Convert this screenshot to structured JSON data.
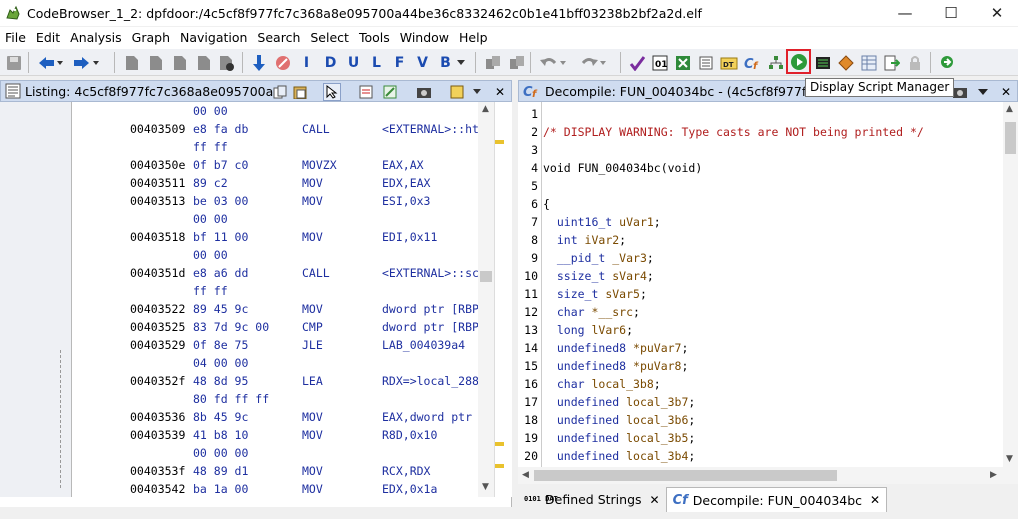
{
  "window": {
    "title": "CodeBrowser_1_2: dpfdoor:/4c5cf8f977fc7c368a8e095700a44be36c8332462c0b1e41bff03238b2bf2a2d.elf",
    "minimize_glyph": "—",
    "maximize_glyph": "☐",
    "close_glyph": "✕"
  },
  "menu": [
    "File",
    "Edit",
    "Analysis",
    "Graph",
    "Navigation",
    "Search",
    "Select",
    "Tools",
    "Window",
    "Help"
  ],
  "toolbar": {
    "letter_buttons": [
      "I",
      "D",
      "U",
      "L",
      "F",
      "V",
      "B"
    ],
    "tooltip": "Display Script Manager",
    "highlight_color": "#e0202a"
  },
  "listing": {
    "title": "Listing:  4c5cf8f977fc7c368a8e095700a44b...",
    "rows": [
      {
        "addr": "",
        "bytes": "00 00",
        "mnem": "",
        "ops": ""
      },
      {
        "addr": "00403509",
        "bytes": "e8 fa db",
        "mnem": "CALL",
        "ops": "<EXTERNAL>::ht"
      },
      {
        "addr": "",
        "bytes": "ff ff",
        "mnem": "",
        "ops": ""
      },
      {
        "addr": "0040350e",
        "bytes": "0f b7 c0",
        "mnem": "MOVZX",
        "ops": "EAX,AX"
      },
      {
        "addr": "00403511",
        "bytes": "89 c2",
        "mnem": "MOV",
        "ops": "EDX,EAX"
      },
      {
        "addr": "00403513",
        "bytes": "be 03 00",
        "mnem": "MOV",
        "ops": "ESI,0x3"
      },
      {
        "addr": "",
        "bytes": "00 00",
        "mnem": "",
        "ops": ""
      },
      {
        "addr": "00403518",
        "bytes": "bf 11 00",
        "mnem": "MOV",
        "ops": "EDI,0x11"
      },
      {
        "addr": "",
        "bytes": "00 00",
        "mnem": "",
        "ops": ""
      },
      {
        "addr": "0040351d",
        "bytes": "e8 a6 dd",
        "mnem": "CALL",
        "ops": "<EXTERNAL>::sc"
      },
      {
        "addr": "",
        "bytes": "ff ff",
        "mnem": "",
        "ops": ""
      },
      {
        "addr": "00403522",
        "bytes": "89 45 9c",
        "mnem": "MOV",
        "ops": "dword ptr [RBP"
      },
      {
        "addr": "00403525",
        "bytes": "83 7d 9c 00",
        "mnem": "CMP",
        "ops": "dword ptr [RBP"
      },
      {
        "addr": "00403529",
        "bytes": "0f 8e 75",
        "mnem": "JLE",
        "ops": "LAB_004039a4"
      },
      {
        "addr": "",
        "bytes": "04 00 00",
        "mnem": "",
        "ops": ""
      },
      {
        "addr": "0040352f",
        "bytes": "48 8d 95",
        "mnem": "LEA",
        "ops": "RDX=>local_288"
      },
      {
        "addr": "",
        "bytes": "80 fd ff ff",
        "mnem": "",
        "ops": ""
      },
      {
        "addr": "00403536",
        "bytes": "8b 45 9c",
        "mnem": "MOV",
        "ops": "EAX,dword ptr"
      },
      {
        "addr": "00403539",
        "bytes": "41 b8 10",
        "mnem": "MOV",
        "ops": "R8D,0x10"
      },
      {
        "addr": "",
        "bytes": "00 00 00",
        "mnem": "",
        "ops": ""
      },
      {
        "addr": "0040353f",
        "bytes": "48 89 d1",
        "mnem": "MOV",
        "ops": "RCX,RDX"
      },
      {
        "addr": "00403542",
        "bytes": "ba 1a 00",
        "mnem": "MOV",
        "ops": "EDX,0x1a"
      }
    ]
  },
  "decompile": {
    "title": "Decompile: FUN_004034bc - (4c5cf8f977fc7...",
    "lines": [
      {
        "n": "1",
        "segs": []
      },
      {
        "n": "2",
        "segs": [
          {
            "t": "/* DISPLAY WARNING: Type casts are NOT being printed */",
            "c": "comment"
          }
        ]
      },
      {
        "n": "3",
        "segs": []
      },
      {
        "n": "4",
        "segs": [
          {
            "t": "void FUN_004034bc(void)",
            "c": "plain"
          }
        ]
      },
      {
        "n": "5",
        "segs": []
      },
      {
        "n": "6",
        "segs": [
          {
            "t": "{",
            "c": "plain"
          }
        ]
      },
      {
        "n": "7",
        "segs": [
          {
            "t": "  uint16_t ",
            "c": "type"
          },
          {
            "t": "uVar1",
            "c": "var"
          },
          {
            "t": ";",
            "c": "plain"
          }
        ]
      },
      {
        "n": "8",
        "segs": [
          {
            "t": "  int ",
            "c": "type"
          },
          {
            "t": "iVar2",
            "c": "var"
          },
          {
            "t": ";",
            "c": "plain"
          }
        ]
      },
      {
        "n": "9",
        "segs": [
          {
            "t": "  __pid_t ",
            "c": "type"
          },
          {
            "t": "_Var3",
            "c": "var"
          },
          {
            "t": ";",
            "c": "plain"
          }
        ]
      },
      {
        "n": "10",
        "segs": [
          {
            "t": "  ssize_t ",
            "c": "type"
          },
          {
            "t": "sVar4",
            "c": "var"
          },
          {
            "t": ";",
            "c": "plain"
          }
        ]
      },
      {
        "n": "11",
        "segs": [
          {
            "t": "  size_t ",
            "c": "type"
          },
          {
            "t": "sVar5",
            "c": "var"
          },
          {
            "t": ";",
            "c": "plain"
          }
        ]
      },
      {
        "n": "12",
        "segs": [
          {
            "t": "  char ",
            "c": "type"
          },
          {
            "t": "*__src",
            "c": "var"
          },
          {
            "t": ";",
            "c": "plain"
          }
        ]
      },
      {
        "n": "13",
        "segs": [
          {
            "t": "  long ",
            "c": "type"
          },
          {
            "t": "lVar6",
            "c": "var"
          },
          {
            "t": ";",
            "c": "plain"
          }
        ]
      },
      {
        "n": "14",
        "segs": [
          {
            "t": "  undefined8 ",
            "c": "type"
          },
          {
            "t": "*puVar7",
            "c": "var"
          },
          {
            "t": ";",
            "c": "plain"
          }
        ]
      },
      {
        "n": "15",
        "segs": [
          {
            "t": "  undefined8 ",
            "c": "type"
          },
          {
            "t": "*puVar8",
            "c": "var"
          },
          {
            "t": ";",
            "c": "plain"
          }
        ]
      },
      {
        "n": "16",
        "segs": [
          {
            "t": "  char ",
            "c": "type"
          },
          {
            "t": "local_3b8",
            "c": "var"
          },
          {
            "t": ";",
            "c": "plain"
          }
        ]
      },
      {
        "n": "17",
        "segs": [
          {
            "t": "  undefined ",
            "c": "type"
          },
          {
            "t": "local_3b7",
            "c": "var"
          },
          {
            "t": ";",
            "c": "plain"
          }
        ]
      },
      {
        "n": "18",
        "segs": [
          {
            "t": "  undefined ",
            "c": "type"
          },
          {
            "t": "local_3b6",
            "c": "var"
          },
          {
            "t": ";",
            "c": "plain"
          }
        ]
      },
      {
        "n": "19",
        "segs": [
          {
            "t": "  undefined ",
            "c": "type"
          },
          {
            "t": "local_3b5",
            "c": "var"
          },
          {
            "t": ";",
            "c": "plain"
          }
        ]
      },
      {
        "n": "20",
        "segs": [
          {
            "t": "  undefined ",
            "c": "type"
          },
          {
            "t": "local_3b4",
            "c": "var"
          },
          {
            "t": ";",
            "c": "plain"
          }
        ]
      }
    ]
  },
  "bottom_tabs": [
    {
      "icon_text": "0101 DAT",
      "label": "Defined Strings",
      "close": "✕"
    },
    {
      "icon_text": "Cf",
      "label": "Decompile: FUN_004034bc",
      "close": "✕"
    }
  ]
}
